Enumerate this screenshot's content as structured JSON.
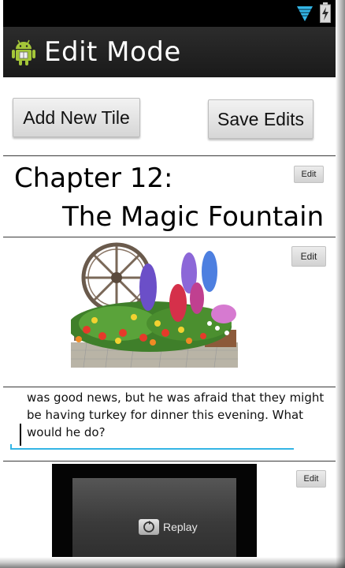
{
  "action_bar": {
    "title": "Edit Mode",
    "icon": "android-icon"
  },
  "status_bar": {
    "icons": [
      "signal-icon",
      "battery-charging-icon"
    ]
  },
  "toolbar": {
    "add_tile_label": "Add New Tile",
    "save_edits_label": "Save Edits"
  },
  "tiles": {
    "title_tile": {
      "line1": "Chapter 12:",
      "line2": "The Magic Fountain",
      "edit_label": "Edit"
    },
    "image_tile": {
      "edit_label": "Edit"
    },
    "text_tile": {
      "lines": [
        "was good news, but he was afraid that they might",
        "be having turkey for dinner this evening. What",
        "would he do?"
      ]
    },
    "video_tile": {
      "replay_label": "Replay",
      "edit_label": "Edit"
    }
  },
  "colors": {
    "action_bar_bg": "#1f1f1f",
    "status_bar_bg": "#000000",
    "text_field_underline": "#33b5e5",
    "android_green": "#a4c639",
    "signal_blue": "#33b5e5"
  }
}
